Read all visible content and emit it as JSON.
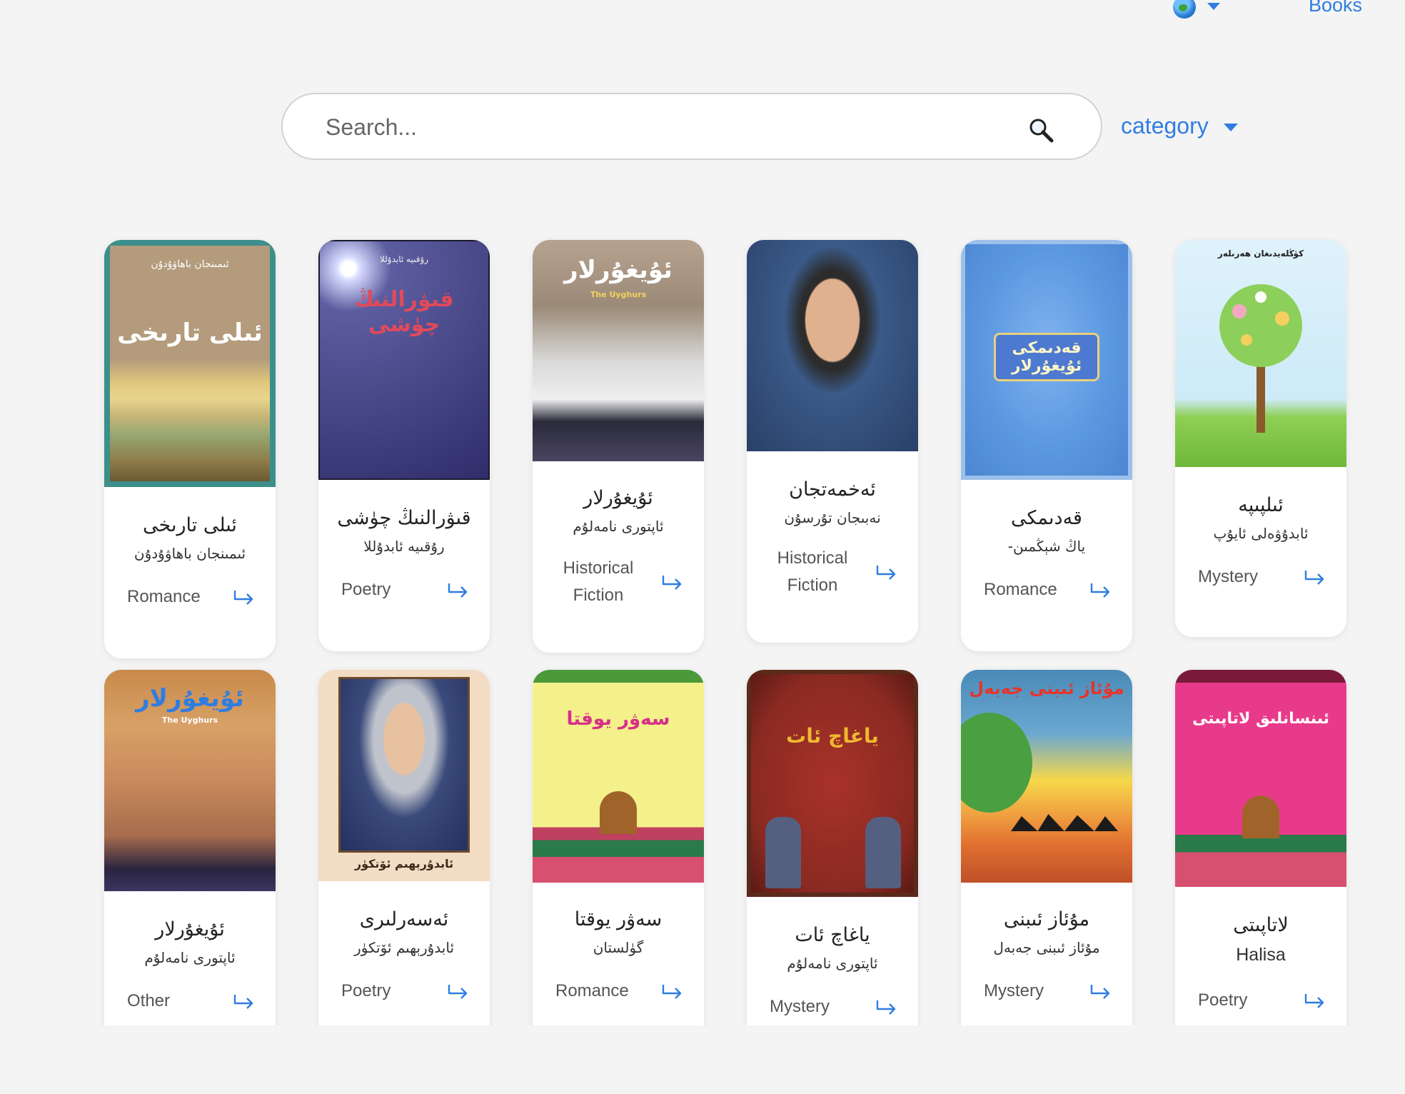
{
  "header": {
    "language_icon": "globe-icon",
    "nav_books": "Books"
  },
  "search": {
    "placeholder": "Search...",
    "icon": "magnifier-icon"
  },
  "filter": {
    "category_label": "category"
  },
  "colors": {
    "accent": "#2f7de1",
    "background": "#f4f4f4",
    "card": "#ffffff"
  },
  "books": [
    {
      "cover_text": "ئىلى تارىخى",
      "cover_top": "ئىمىنجان باھاۋۇدۇن",
      "title": "ئىلى تارىخى",
      "author": "ئىمىنجان باھاۋۇدۇن",
      "genre": "Romance"
    },
    {
      "cover_text": "قىۋرالنىڭ چۈشى",
      "cover_top": "رۇقىيە ئابدۇللا",
      "title": "قىۋرالنىڭ چۈشى",
      "author": "رۇقىيە ئابدۇللا",
      "genre": "Poetry"
    },
    {
      "cover_text": "ئۇيغۇرلار",
      "cover_top": "The Uyghurs",
      "title": "ئۇيغۇرلار",
      "author": "ئاپتورى نامەلۇم",
      "genre": "Historical Fiction"
    },
    {
      "cover_text": "",
      "cover_top": "",
      "title": "ئەخمەتجان",
      "author": "نەبىجان تۇرسۇن",
      "genre": "Historical Fiction"
    },
    {
      "cover_text": "قەدىمكى ئۇيغۇرلار",
      "cover_top": "",
      "title": "قەدىمكى",
      "author": "ياڭ شېڭمىن-",
      "genre": "Romance"
    },
    {
      "cover_text": "كۈڭلەيدىغان ھەرىلەر",
      "cover_top": "",
      "title": "ئىلپىپە",
      "author": "ئابدۇۋەلى ئايۇپ",
      "genre": "Mystery"
    },
    {
      "cover_text": "ئۇيغۇرلار",
      "cover_top": "The Uyghurs",
      "title": "ئۇيغۇرلار",
      "author": "ئاپتورى نامەلۇم",
      "genre": "Other"
    },
    {
      "cover_text": "ئابدۇرېھىم ئۆتكۈر",
      "cover_top": "",
      "title": "ئەسەرلىرى",
      "author": "ئابدۇرېھىم ئۆتكۈر",
      "genre": "Poetry"
    },
    {
      "cover_text": "سەۋر يوقتا",
      "cover_top": "",
      "title": "سەۋر يوقتا",
      "author": "گۈلستان",
      "genre": "Romance"
    },
    {
      "cover_text": "ياغاچ ئات",
      "cover_top": "",
      "title": "ياغاچ ئات",
      "author": "ئاپتورى نامەلۇم",
      "genre": "Mystery"
    },
    {
      "cover_text": "مۇئاز ئىبنى جەبەل",
      "cover_top": "",
      "title": "مۇئاز ئىبنى",
      "author": "مۇئاز ئىبنى جەبەل",
      "genre": "Mystery"
    },
    {
      "cover_text": "ئىنسانلىق لاتاپىتى",
      "cover_top": "",
      "title": "لاتاپىتى",
      "author": "Halisa",
      "genre": "Poetry"
    }
  ]
}
